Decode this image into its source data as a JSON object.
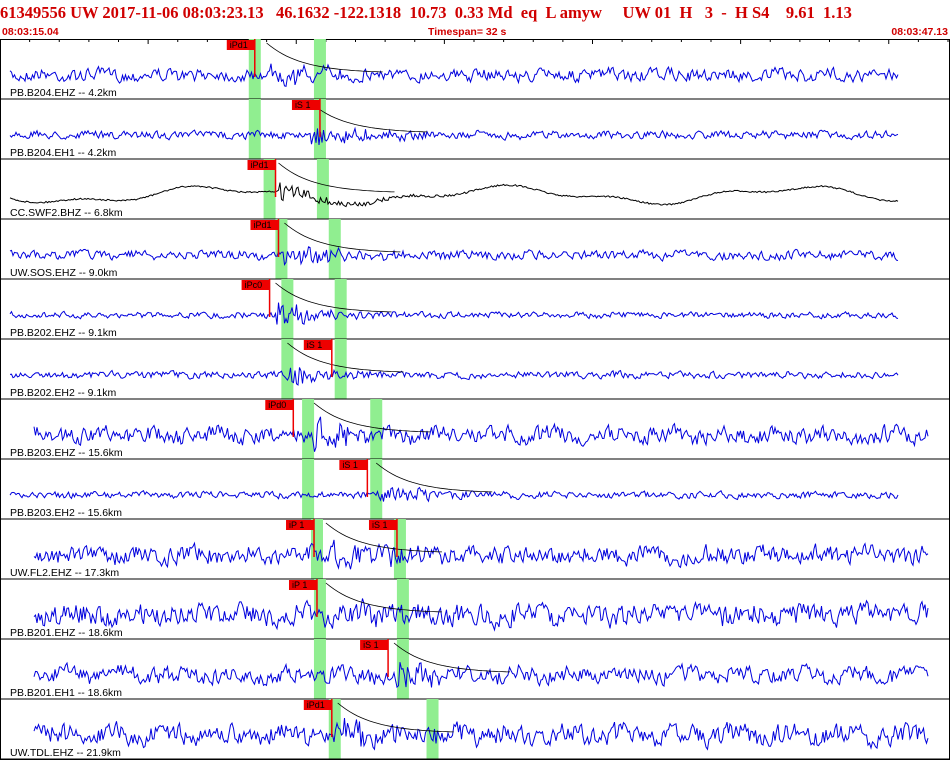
{
  "header": {
    "event_line": "61349556 UW 2017-11-06 08:03:23.13   46.1632 -122.1318  10.73  0.33 Md  eq  L amyw     UW 01  H   3  -  H S4    9.61  1.13",
    "start_time": "08:03:15.04",
    "timespan": "Timespan=  32 s",
    "end_time": "08:03:47.13"
  },
  "colors": {
    "trace": "#0000dd",
    "trace_cc": "#000000",
    "pick": "#ee0000",
    "window": "#90ee90",
    "title": "#d00000"
  },
  "chart_data": {
    "type": "line",
    "title": "61349556 UW 2017-11-06 08:03:23.13",
    "xlabel": "",
    "ylabel": "",
    "x_unit": "s",
    "xlim": [
      0,
      32
    ],
    "traces": [
      {
        "label": "PB.B204.EHZ -- 4.2km",
        "picks": [
          {
            "name": "iPd1",
            "t": 8.6
          }
        ],
        "p_window": 8.6,
        "s_window": 10.8,
        "signal_start": 9.0,
        "amp": 0.35,
        "color": "blue"
      },
      {
        "label": "PB.B204.EH1 -- 4.2km",
        "picks": [
          {
            "name": "iS 1",
            "t": 10.8
          }
        ],
        "p_window": 8.6,
        "s_window": 10.8,
        "signal_start": 10.5,
        "amp": 0.15,
        "color": "blue"
      },
      {
        "label": "CC.SWF2.BHZ -- 6.8km",
        "picks": [
          {
            "name": "iPd1",
            "t": 9.3
          }
        ],
        "p_window": 9.1,
        "s_window": 10.9,
        "signal_start": 9.4,
        "amp": 0.3,
        "color": "black"
      },
      {
        "label": "UW.SOS.EHZ -- 9.0km",
        "picks": [
          {
            "name": "iPd1",
            "t": 9.4
          }
        ],
        "p_window": 9.5,
        "s_window": 11.3,
        "signal_start": 9.6,
        "amp": 0.2,
        "color": "blue"
      },
      {
        "label": "PB.B202.EHZ -- 9.1km",
        "picks": [
          {
            "name": "iPc0",
            "t": 9.1
          }
        ],
        "p_window": 9.7,
        "s_window": 11.5,
        "signal_start": 9.3,
        "amp": 0.08,
        "color": "blue"
      },
      {
        "label": "PB.B202.EH2 -- 9.1km",
        "picks": [
          {
            "name": "iS 1",
            "t": 11.2
          }
        ],
        "p_window": 9.7,
        "s_window": 11.5,
        "signal_start": 9.7,
        "amp": 0.12,
        "color": "blue"
      },
      {
        "label": "PB.B203.EHZ -- 15.6km",
        "picks": [
          {
            "name": "iPd0",
            "t": 9.9
          }
        ],
        "p_window": 10.4,
        "s_window": 12.7,
        "signal_start": 10.6,
        "amp": 0.55,
        "color": "blue"
      },
      {
        "label": "PB.B203.EH2 -- 15.6km",
        "picks": [
          {
            "name": "iS 1",
            "t": 12.4
          }
        ],
        "p_window": 10.4,
        "s_window": 12.7,
        "signal_start": 12.7,
        "amp": 0.1,
        "color": "blue"
      },
      {
        "label": "UW.FL2.EHZ -- 17.3km",
        "picks": [
          {
            "name": "iP 1",
            "t": 10.6
          },
          {
            "name": "iS 1",
            "t": 13.4
          }
        ],
        "p_window": 10.7,
        "s_window": 13.5,
        "signal_start": 11.0,
        "amp": 0.6,
        "color": "blue"
      },
      {
        "label": "PB.B201.EHZ -- 18.6km",
        "picks": [
          {
            "name": "iP 1",
            "t": 10.7
          }
        ],
        "p_window": 10.8,
        "s_window": 13.6,
        "signal_start": 11.0,
        "amp": 0.75,
        "color": "blue"
      },
      {
        "label": "PB.B201.EH1 -- 18.6km",
        "picks": [
          {
            "name": "iS 1",
            "t": 13.1
          }
        ],
        "p_window": 10.8,
        "s_window": 13.6,
        "signal_start": 13.3,
        "amp": 0.55,
        "color": "blue"
      },
      {
        "label": "UW.TDL.EHZ -- 21.9km",
        "picks": [
          {
            "name": "iPd1",
            "t": 11.2
          }
        ],
        "p_window": 11.3,
        "s_window": 14.6,
        "signal_start": 11.4,
        "amp": 0.7,
        "color": "blue"
      }
    ]
  }
}
